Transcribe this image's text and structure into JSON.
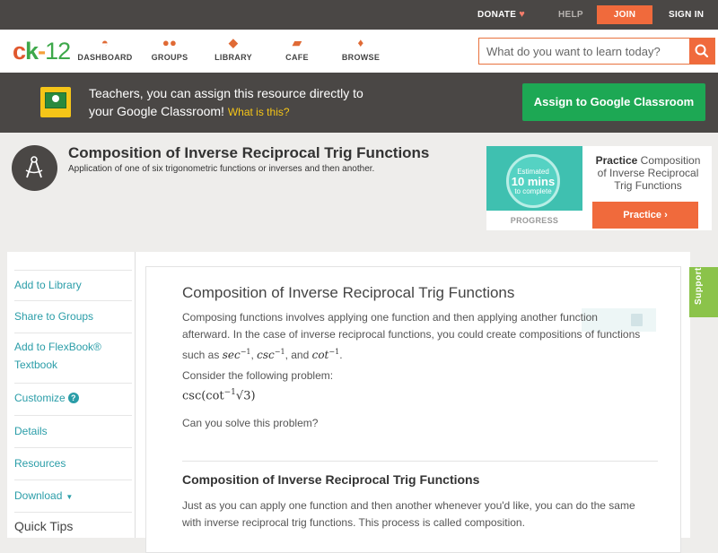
{
  "topbar": {
    "donate": "DONATE",
    "help": "HELP",
    "join": "JOIN",
    "signin": "SIGN IN"
  },
  "nav": {
    "logo": {
      "c": "c",
      "k": "k",
      "dash": "-",
      "n12": "12"
    },
    "items": [
      {
        "label": "DASHBOARD"
      },
      {
        "label": "GROUPS"
      },
      {
        "label": "LIBRARY"
      },
      {
        "label": "CAFE"
      },
      {
        "label": "BROWSE"
      }
    ],
    "search_placeholder": "What do you want to learn today?"
  },
  "banner": {
    "line1": "Teachers, you can assign this resource directly to",
    "line2": "your Google Classroom!",
    "what": "What is this?",
    "button": "Assign to Google Classroom"
  },
  "concept": {
    "title": "Composition of Inverse Reciprocal Trig Functions",
    "subtitle": "Application of one of six trigonometric functions or inverses and then another."
  },
  "practice": {
    "estimated": "Estimated",
    "mins": "10 mins",
    "to_complete": "to complete",
    "progress_label": "PROGRESS",
    "bold": "Practice",
    "text": "Composition of Inverse Reciprocal Trig Functions",
    "button": "Practice"
  },
  "sidebar": {
    "items": [
      {
        "label": "Add to Library"
      },
      {
        "label": "Share to Groups"
      },
      {
        "label": "Add to FlexBook®"
      },
      {
        "label": "Textbook"
      },
      {
        "label": "Customize"
      },
      {
        "label": "Details"
      },
      {
        "label": "Resources"
      },
      {
        "label": "Download"
      }
    ],
    "quick_tips": "Quick Tips"
  },
  "article": {
    "title": "Composition of Inverse Reciprocal Trig Functions",
    "p1a": "Composing functions involves applying one function and then applying another function",
    "p1b": "afterward. In the case of inverse reciprocal functions, you could create compositions of functions",
    "p1c_pre": "such as",
    "p1c_and": ", and",
    "fn_sec": "sec",
    "fn_csc": "csc",
    "fn_cot": "cot",
    "sup": "−1",
    "p2": "Consider the following problem:",
    "math": "csc(cot",
    "math_arg": "√3)",
    "p3": "Can you solve this problem?",
    "section_title": "Composition of Inverse Reciprocal Trig Functions",
    "p4a": "Just as you can apply one function and then another whenever you'd like, you can do the same",
    "p4b": "with inverse reciprocal trig functions. This process is called composition."
  },
  "support": "Support"
}
